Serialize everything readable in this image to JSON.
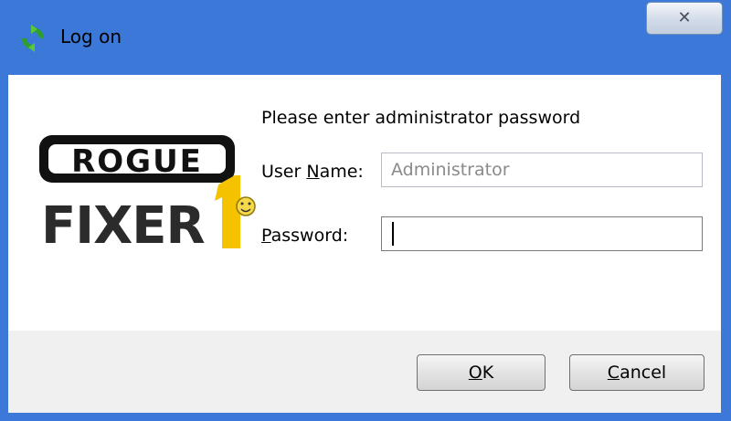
{
  "window": {
    "title": "Log on",
    "close_label": "✕",
    "title_icon": "refresh-arrows-icon"
  },
  "logo": {
    "name": "ROGUEKILLER FIXER 1 logo",
    "line1": "ROGUE",
    "line2": "FIXER",
    "digit": "1"
  },
  "form": {
    "prompt": "Please enter administrator password",
    "user_label_pre": "User ",
    "user_label_u": "N",
    "user_label_post": "ame:",
    "user_value": "Administrator",
    "pass_label_u": "P",
    "pass_label_post": "assword:",
    "pass_value": ""
  },
  "buttons": {
    "ok_u": "O",
    "ok_post": "K",
    "cancel_u": "C",
    "cancel_post": "ancel"
  },
  "colors": {
    "titlebar": "#3c78d8",
    "footer": "#f0f0f0",
    "logo_yellow": "#f5c200"
  }
}
